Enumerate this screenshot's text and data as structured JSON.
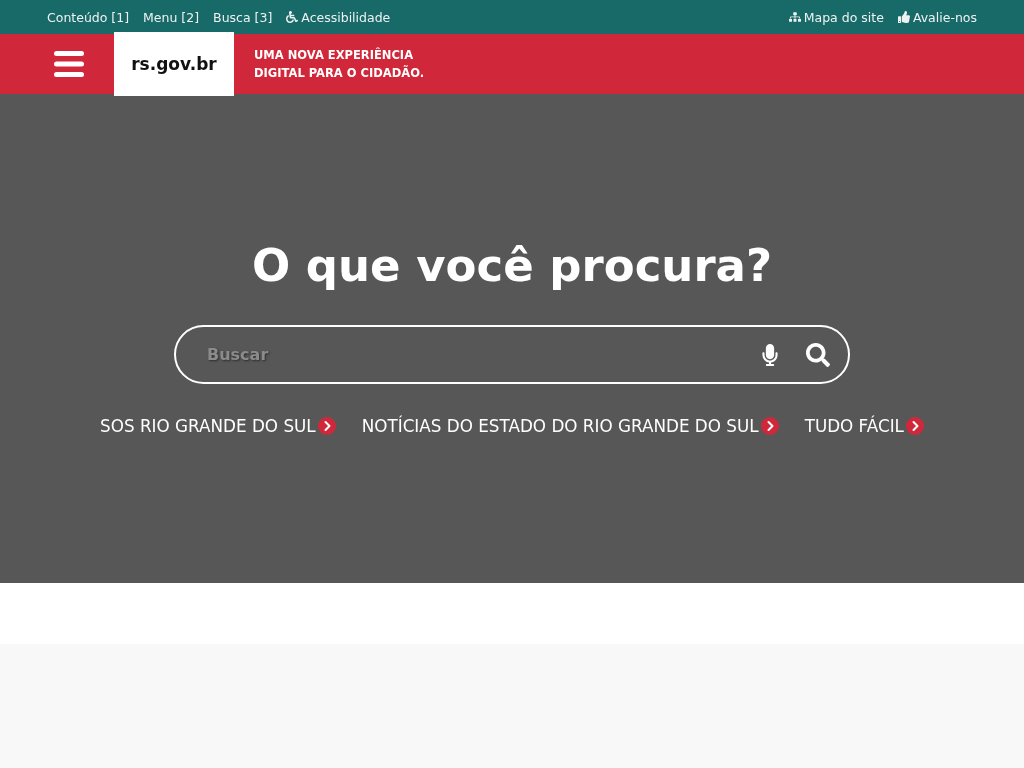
{
  "top_bar": {
    "shortcuts": [
      {
        "label": "Conteúdo [1]",
        "kind": "plain"
      },
      {
        "label": "Menu [2]",
        "kind": "plain"
      },
      {
        "label": "Busca [3]",
        "kind": "plain"
      },
      {
        "label": "Acessibilidade",
        "kind": "accessibility"
      }
    ],
    "right_links": [
      {
        "label": "Mapa do site",
        "kind": "sitemap"
      },
      {
        "label": "Avalie-nos",
        "kind": "rate"
      }
    ]
  },
  "header": {
    "logo": "rs.gov.br",
    "tagline_lines": [
      "UMA NOVA EXPERIÊNCIA",
      "DIGITAL PARA O CIDADÃO."
    ]
  },
  "hero": {
    "title": "O que você procura?",
    "search": {
      "placeholder": "Buscar"
    },
    "quick_links": [
      {
        "label": "SOS RIO GRANDE DO SUL"
      },
      {
        "label": "NOTÍCIAS DO ESTADO DO RIO GRANDE DO SUL"
      },
      {
        "label": "TUDO FÁCIL"
      }
    ]
  }
}
